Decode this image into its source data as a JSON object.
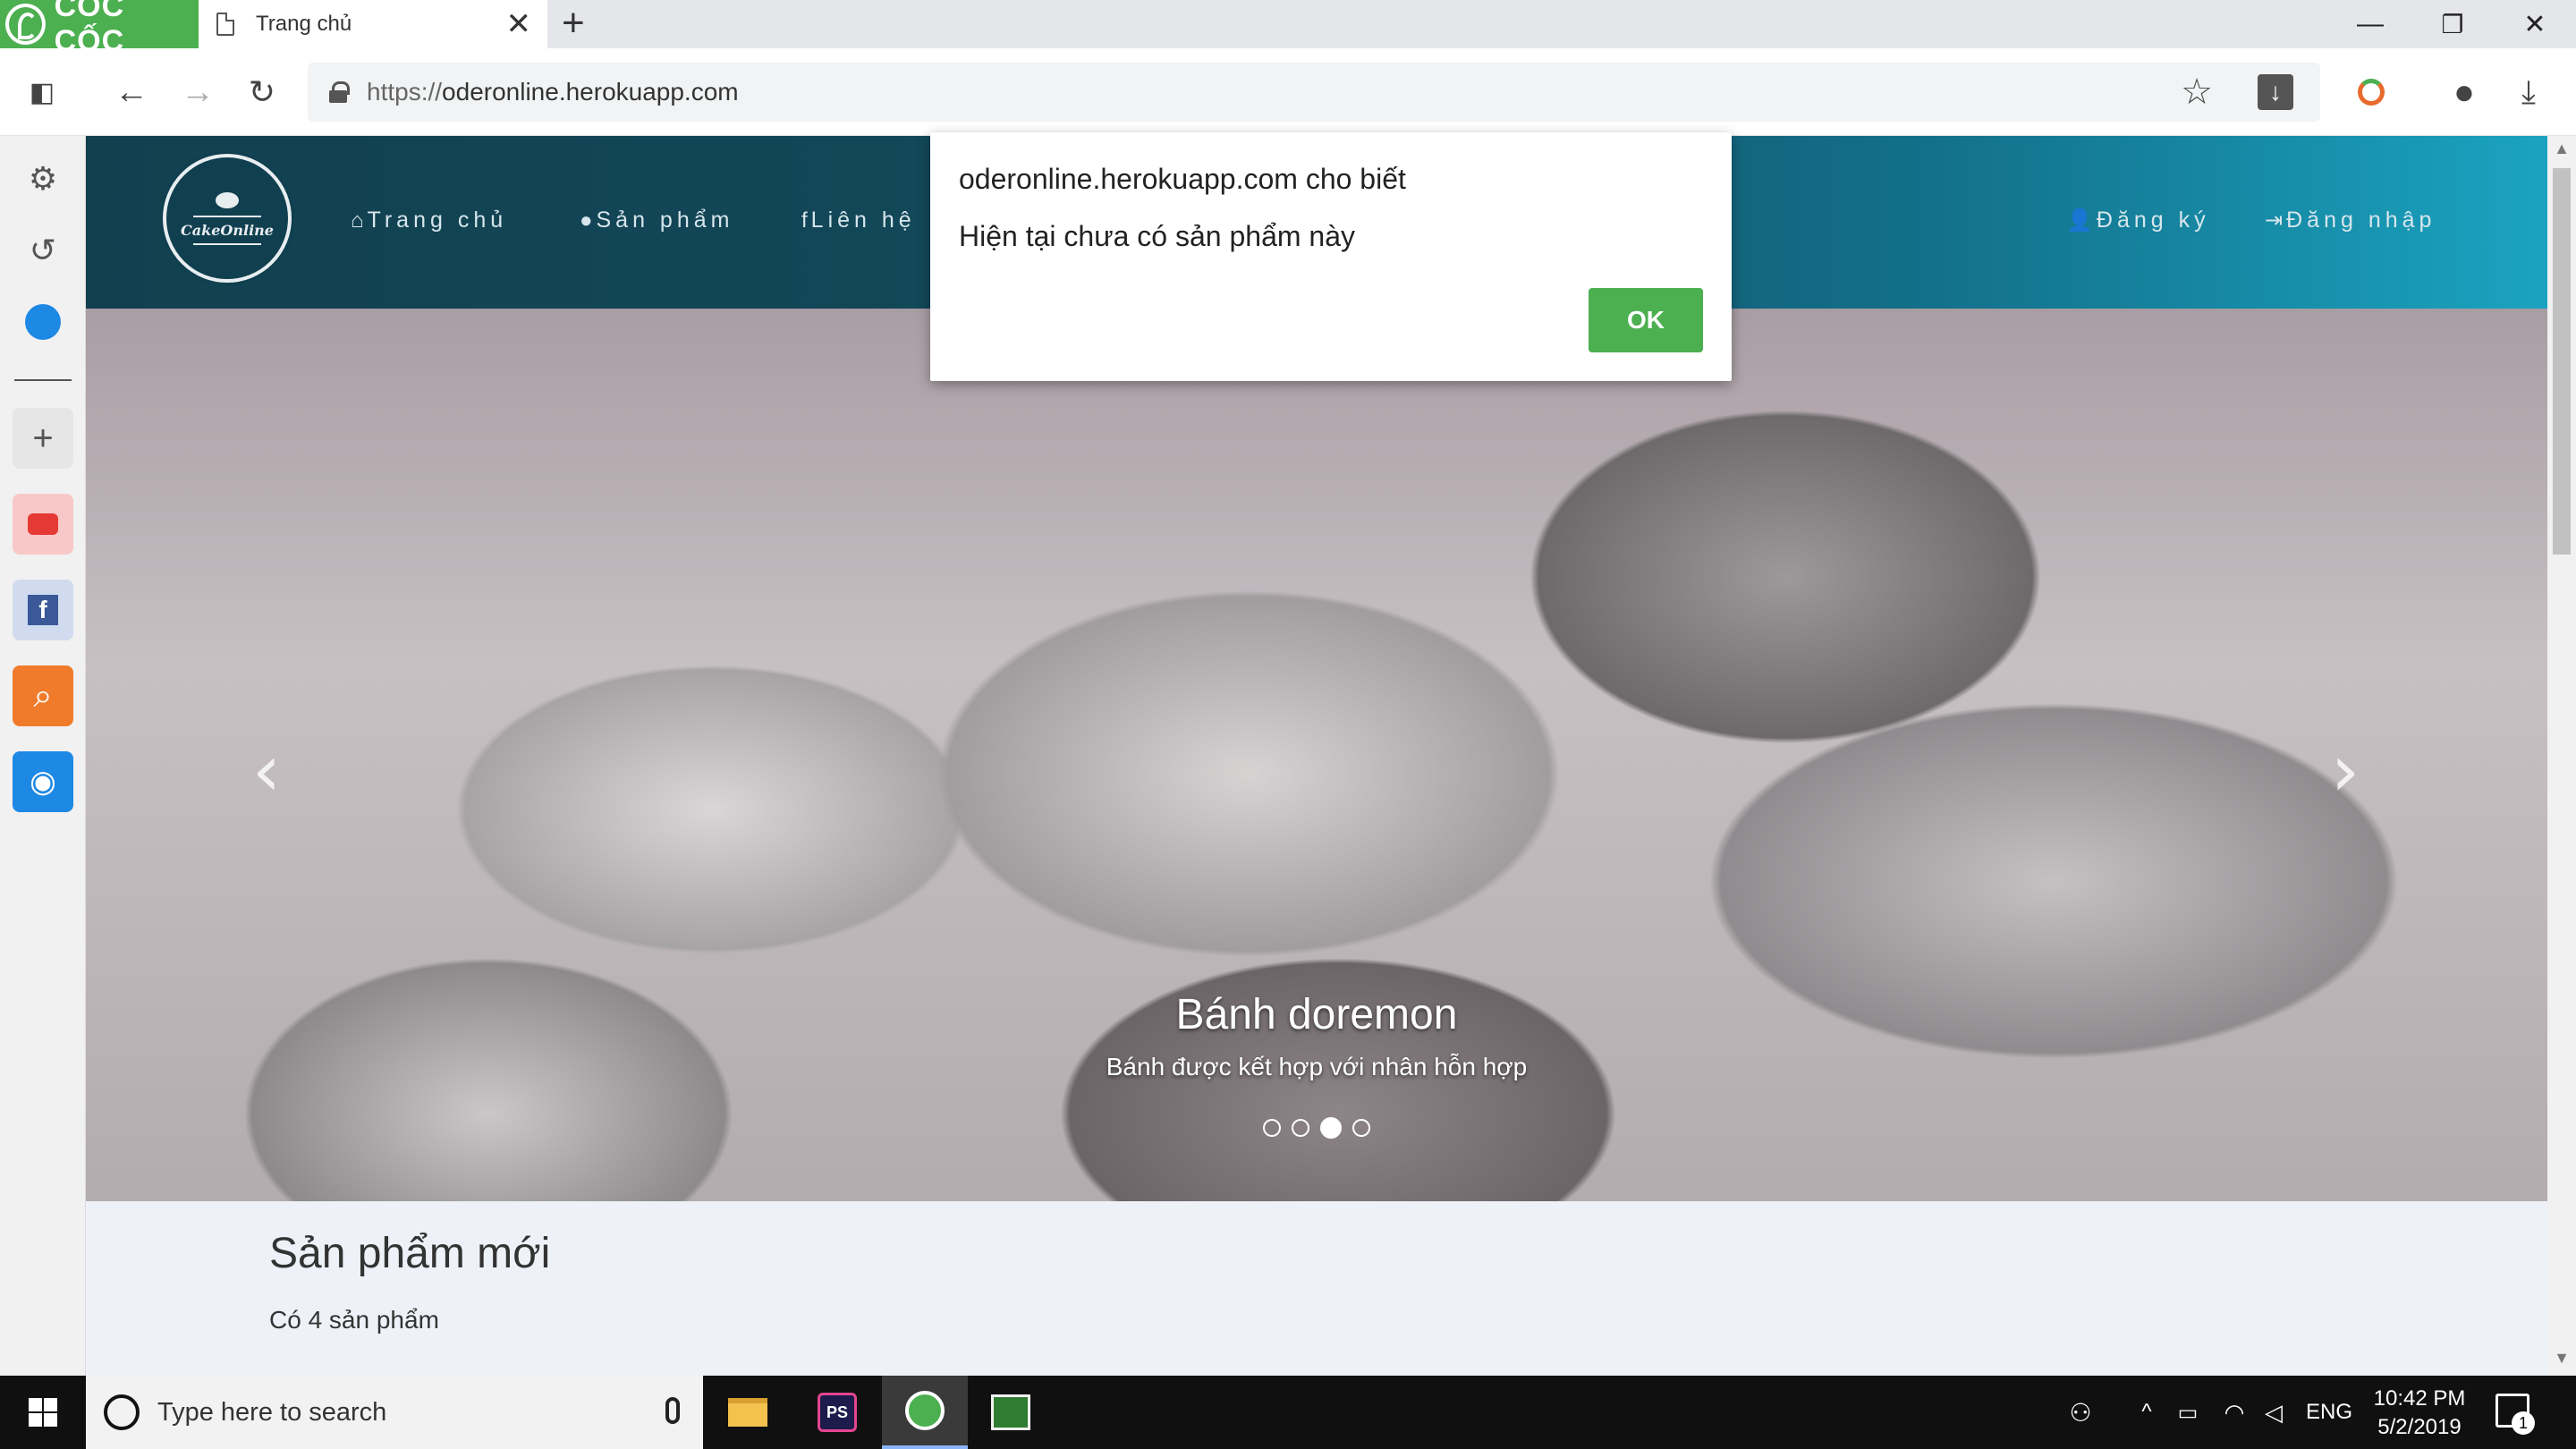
{
  "browser": {
    "brand": "CỐC CỐC",
    "tab_title": "Trang chủ",
    "tab_close": "✕",
    "new_tab": "+",
    "url_scheme": "https://",
    "url_host": "oderonline.herokuapp.com",
    "window_controls": {
      "minimize": "—",
      "restore": "❐",
      "close": "✕"
    }
  },
  "site": {
    "logo_text": "CakeOnline",
    "nav": [
      {
        "icon": "⌂",
        "label": "Trang chủ"
      },
      {
        "icon": "●",
        "label": "Sản phẩm"
      },
      {
        "icon": "f",
        "label": "Liên hệ"
      }
    ],
    "auth": [
      {
        "icon": "👤",
        "label": "Đăng ký"
      },
      {
        "icon": "⇥",
        "label": "Đăng nhập"
      }
    ],
    "carousel": {
      "title": "Bánh doremon",
      "subtitle": "Bánh được kết hợp với nhân hỗn hợp",
      "slide_count": 4,
      "active_index": 2,
      "prev": "‹",
      "next": "›"
    },
    "section_title": "Sản phẩm mới",
    "section_count": "Có 4 sản phẩm"
  },
  "dialog": {
    "origin": "oderonline.herokuapp.com cho biết",
    "message": "Hiện tại chưa có sản phẩm này",
    "ok_label": "OK",
    "ok_color": "#4caf50"
  },
  "taskbar": {
    "search_placeholder": "Type here to search",
    "language": "ENG",
    "time": "10:42 PM",
    "date": "5/2/2019",
    "notification_count": "1",
    "ps_label": "PS"
  },
  "colors": {
    "brand_green": "#4caf50",
    "header_start": "#12404f",
    "header_end": "#1aa3c0"
  }
}
